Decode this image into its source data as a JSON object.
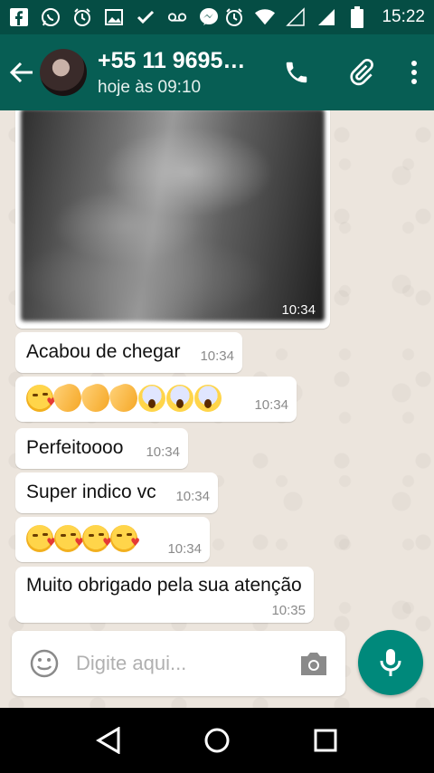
{
  "status_bar": {
    "time": "15:22",
    "icons": [
      "facebook-icon",
      "whatsapp-icon",
      "alarm-icon",
      "image-icon",
      "check-icon",
      "voicemail-icon",
      "messenger-icon",
      "alarm-icon",
      "wifi-icon",
      "signal-icon",
      "signal-icon",
      "battery-icon"
    ]
  },
  "header": {
    "contact_name": "+55 11 9695…",
    "last_seen": "hoje às 09:10",
    "icons": [
      "back-arrow-icon",
      "phone-icon",
      "paperclip-icon",
      "more-vert-icon"
    ]
  },
  "messages": [
    {
      "type": "image",
      "time": "10:34"
    },
    {
      "type": "text",
      "text": "Acabou de chegar",
      "time": "10:34"
    },
    {
      "type": "emoji",
      "emoji": [
        "face-blowing-kiss",
        "clapping-hands",
        "clapping-hands",
        "clapping-hands",
        "face-screaming",
        "face-screaming",
        "face-screaming"
      ],
      "time": "10:34"
    },
    {
      "type": "text",
      "text": "Perfeitoooo",
      "time": "10:34"
    },
    {
      "type": "text",
      "text": "Super indico vc",
      "time": "10:34"
    },
    {
      "type": "emoji",
      "emoji": [
        "face-blowing-kiss",
        "face-blowing-kiss",
        "face-blowing-kiss",
        "face-blowing-kiss"
      ],
      "time": "10:34"
    },
    {
      "type": "text",
      "text": "Muito obrigado pela sua atenção",
      "time": "10:35"
    }
  ],
  "composer": {
    "placeholder": "Digite aqui...",
    "icons": [
      "emoji-icon",
      "camera-icon",
      "microphone-icon"
    ]
  },
  "colors": {
    "status_bar": "#054d44",
    "app_bar": "#075e54",
    "chat_bg": "#ece5dd",
    "bubble": "#ffffff",
    "fab": "#00897b"
  },
  "nav_bar": {
    "icons": [
      "back-triangle-icon",
      "home-circle-icon",
      "recents-square-icon"
    ]
  }
}
